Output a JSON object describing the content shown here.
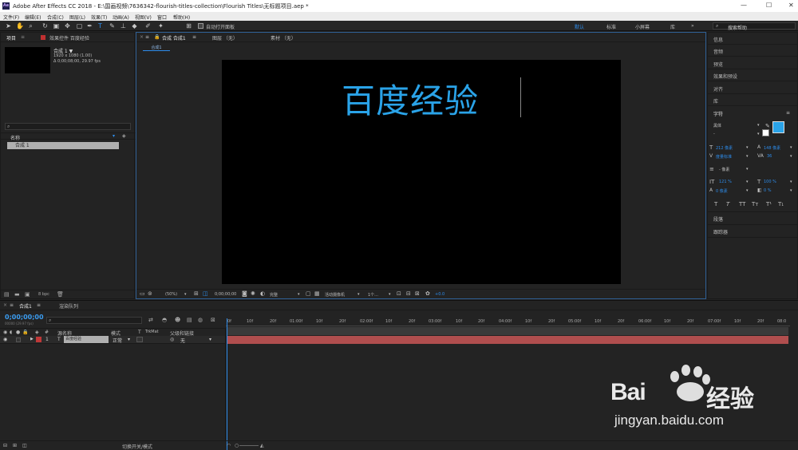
{
  "window": {
    "title": "Adobe After Effects CC 2018 - E:\\国画视频\\7636342-flourish-titles-collection\\Flourish Titles\\无标题项目.aep *",
    "logo": "Ae",
    "minimize": "—",
    "maximize": "☐",
    "close": "✕"
  },
  "menu": [
    "文件(F)",
    "编辑(E)",
    "合成(C)",
    "图层(L)",
    "效果(T)",
    "动画(A)",
    "视图(V)",
    "窗口",
    "帮助(H)"
  ],
  "toolbar": {
    "auto_open": "自动打开面板",
    "workspaces": [
      "默认",
      "标准",
      "小屏幕",
      "库"
    ],
    "more": "»",
    "search_placeholder": "搜索帮助"
  },
  "project_panel": {
    "tab_project": "项目",
    "tab_effects": "效果控件 百度经验",
    "comp_name": "合成 1 ▼",
    "comp_size": "1920 x 1080 (1.00)",
    "comp_duration": "Δ 0;00;08;00, 29.97 fps",
    "search_icon": "⌕",
    "col_name": "名称",
    "item": "合成 1",
    "bpc": "8 bpc"
  },
  "comp_panel": {
    "tab_comp": "合成 合成1",
    "tab_layer": "图层 （无）",
    "tab_footage": "素材 （无）",
    "sub_tab": "合成1",
    "canvas_text": "百度经验",
    "zoom": "(50%)",
    "timecode": "0;00;00;00",
    "quality": "完整",
    "camera": "活动摄像机",
    "views": "1个...",
    "exposure": "+0.0"
  },
  "right_panel": {
    "items_top": [
      "信息",
      "音频",
      "预览",
      "效果和预设",
      "对齐",
      "库"
    ],
    "character": "字符",
    "font": "黑体",
    "font_style": "-",
    "size": "212 像素",
    "leading": "148 像素",
    "kerning": "度量标准",
    "tracking": "36",
    "stroke": "- 像素",
    "vscale": "121 %",
    "hscale": "100 %",
    "baseline": "0 像素",
    "tsume": "0 %",
    "styles": [
      "T",
      "T",
      "TT",
      "Tт",
      "T¹",
      "T₁"
    ],
    "items_bottom": [
      "段落",
      "跟踪器"
    ],
    "text_color": "#2aa3e8"
  },
  "timeline": {
    "tab_comp": "合成1",
    "tab_render": "渲染队列",
    "timecode": "0;00;00;00",
    "fps": "00000 (29.97 fps)",
    "ticks": [
      "0f",
      "10f",
      "20f",
      "01:00f",
      "10f",
      "20f",
      "02:00f",
      "10f",
      "20f",
      "03:00f",
      "10f",
      "20f",
      "04:00f",
      "10f",
      "20f",
      "05:00f",
      "10f",
      "20f",
      "06:00f",
      "10f",
      "20f",
      "07:00f",
      "10f",
      "20f",
      "08:0"
    ],
    "col_num": "#",
    "col_source": "源名称",
    "col_mode": "模式",
    "col_t": "T",
    "col_trkmat": "TrkMat",
    "col_parent": "父级和链接",
    "layer_index": "1",
    "layer_type": "T",
    "layer_name": "百度经验",
    "layer_mode": "正常",
    "layer_parent": "无",
    "layer_color": "#b04e4e",
    "toggle_modes": "切换开关/模式"
  },
  "watermark": {
    "brand_left": "Bai",
    "brand_right": "经验",
    "url": "jingyan.baidu.com"
  }
}
